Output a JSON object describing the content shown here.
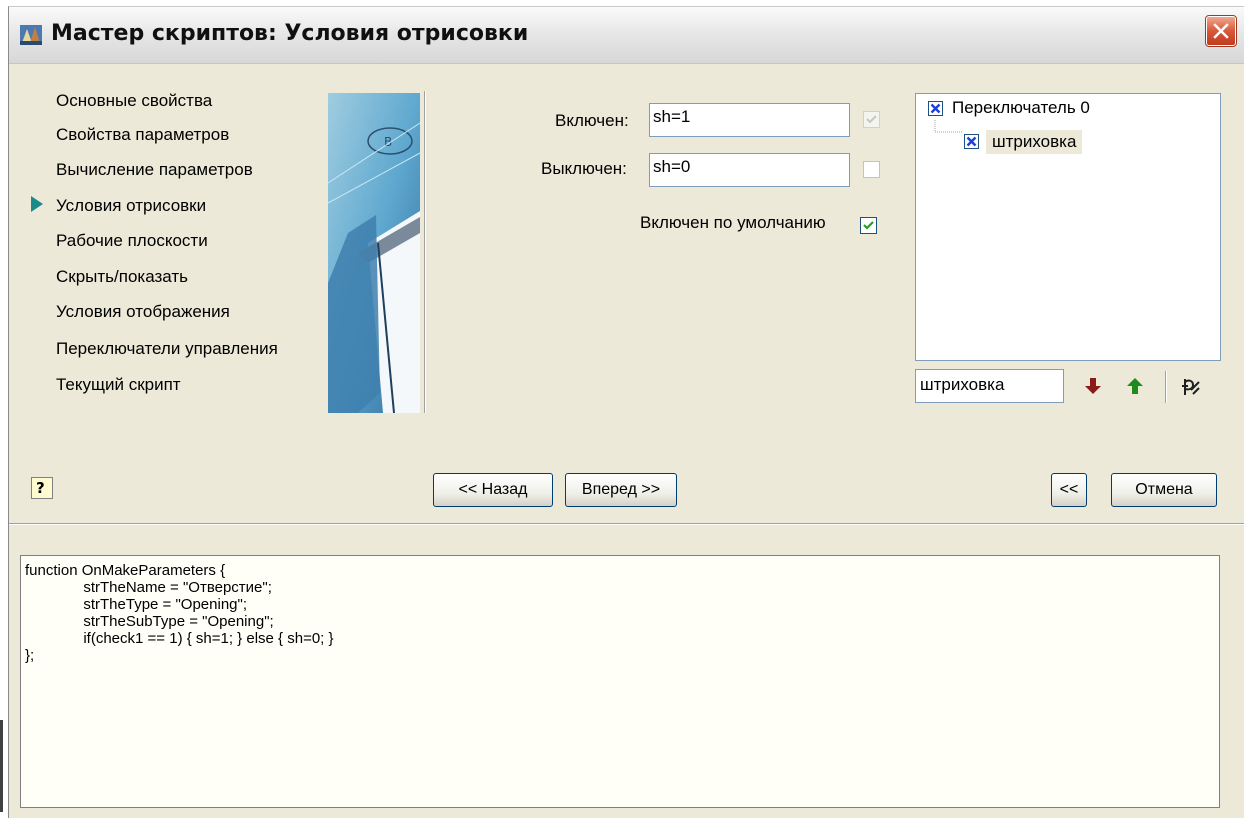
{
  "window": {
    "title": "Мастер скриптов:  Условия отрисовки"
  },
  "nav": {
    "items": [
      {
        "label": "Основные свойства",
        "active": false
      },
      {
        "label": "Свойства параметров",
        "active": false
      },
      {
        "label": "Вычисление параметров",
        "active": false
      },
      {
        "label": "Условия отрисовки",
        "active": true
      },
      {
        "label": "Рабочие плоскости",
        "active": false
      },
      {
        "label": "Скрыть/показать",
        "active": false
      },
      {
        "label": "Условия отображения",
        "active": false
      },
      {
        "label": "Переключатели управления",
        "active": false
      },
      {
        "label": "Текущий скрипт",
        "active": false
      }
    ]
  },
  "form": {
    "on_label": "Включен:",
    "on_value": "sh=1",
    "on_checked": true,
    "off_label": "Выключен:",
    "off_value": "sh=0",
    "off_checked": false,
    "default_label": "Включен по умолчанию",
    "default_checked": true
  },
  "tree": {
    "root_label": "Переключатель 0",
    "child_label": "штриховка"
  },
  "rename": {
    "value": "штриховка"
  },
  "tools": {
    "down_icon": "arrow-down-icon",
    "up_icon": "arrow-up-icon",
    "delete_icon": "delete-icon"
  },
  "buttons": {
    "help": "?",
    "back": "<< Назад",
    "next": "Вперед >>",
    "collapse": "<<",
    "cancel": "Отмена"
  },
  "code": {
    "lines": [
      "function OnMakeParameters {",
      "              strTheName = \"Отверстие\";",
      "              strTheType = \"Opening\";",
      "              strTheSubType = \"Opening\";",
      "              if(check1 == 1) { sh=1; } else { sh=0; }",
      "};"
    ]
  },
  "colors": {
    "arrow_down": "#8b1a1a",
    "arrow_up": "#1f8a1f",
    "nav_arrow": "#1a8a8a",
    "check_blue": "#1c3fd8"
  }
}
